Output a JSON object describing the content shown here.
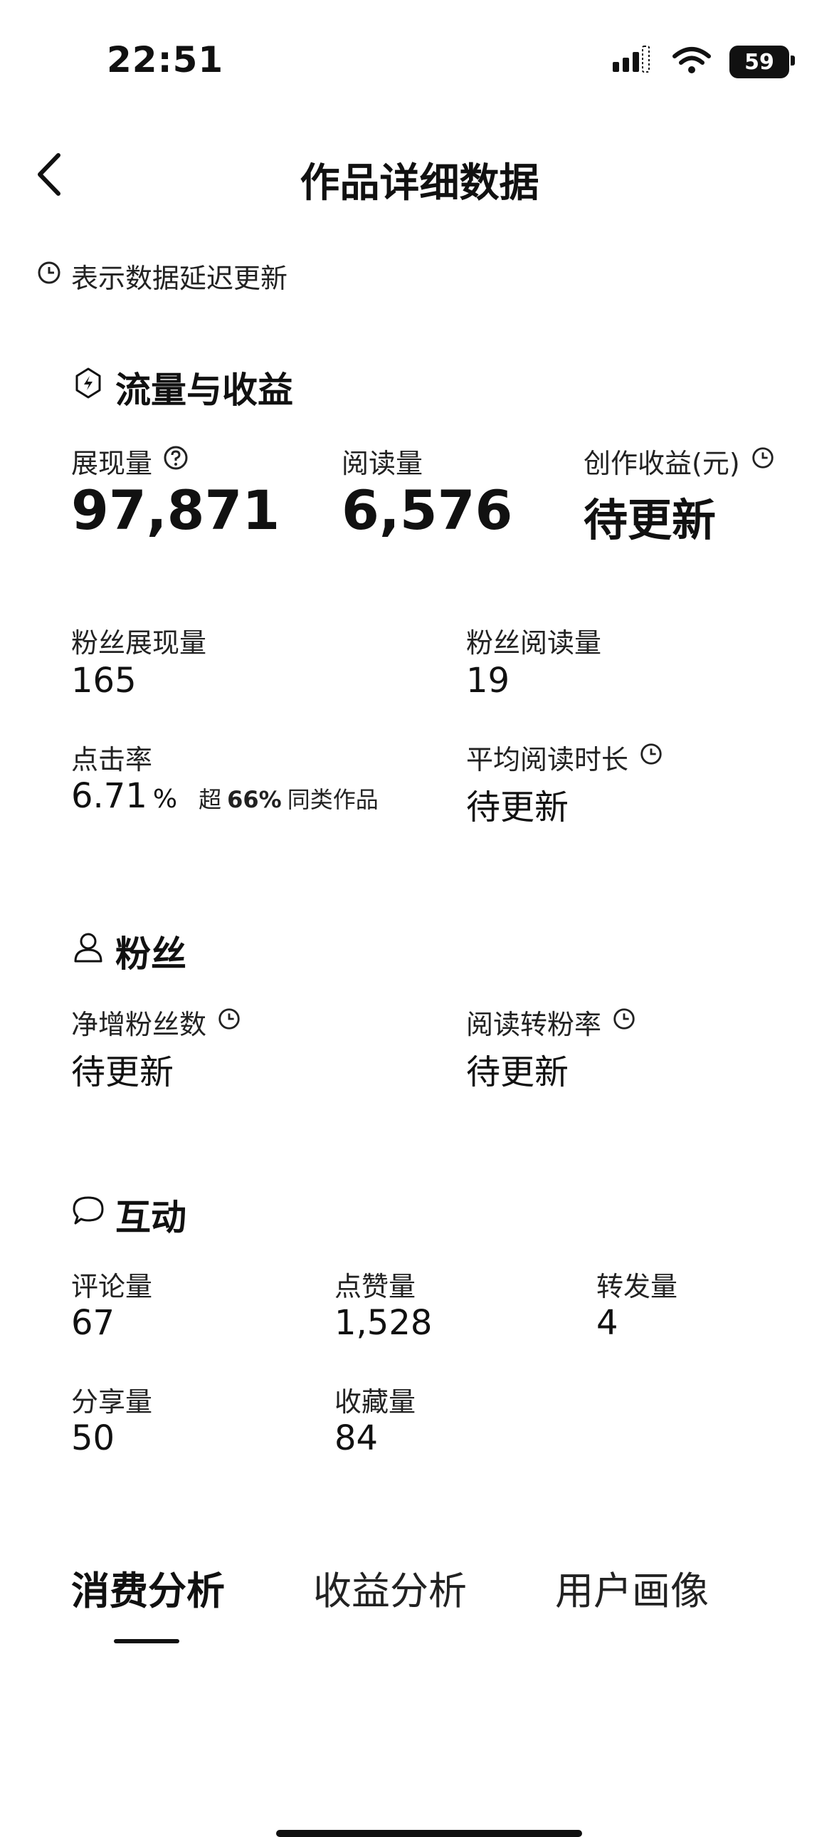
{
  "status_bar": {
    "time": "22:51",
    "battery": "59"
  },
  "nav": {
    "title": "作品详细数据"
  },
  "note": {
    "text": "表示数据延迟更新"
  },
  "traffic": {
    "title": "流量与收益",
    "impressions": {
      "label": "展现量",
      "value": "97,871"
    },
    "reads": {
      "label": "阅读量",
      "value": "6,576"
    },
    "earnings": {
      "label": "创作收益(元)",
      "value": "待更新"
    },
    "fan_impressions": {
      "label": "粉丝展现量",
      "value": "165"
    },
    "fan_reads": {
      "label": "粉丝阅读量",
      "value": "19"
    },
    "ctr": {
      "label": "点击率",
      "value": "6.71",
      "unit": "%",
      "compare_prefix": "超",
      "compare_value": "66%",
      "compare_suffix": "同类作品"
    },
    "avg_read_time": {
      "label": "平均阅读时长",
      "value": "待更新"
    }
  },
  "fans": {
    "title": "粉丝",
    "net_gain": {
      "label": "净增粉丝数",
      "value": "待更新"
    },
    "conversion": {
      "label": "阅读转粉率",
      "value": "待更新"
    }
  },
  "interaction": {
    "title": "互动",
    "comments": {
      "label": "评论量",
      "value": "67"
    },
    "likes": {
      "label": "点赞量",
      "value": "1,528"
    },
    "forwards": {
      "label": "转发量",
      "value": "4"
    },
    "shares": {
      "label": "分享量",
      "value": "50"
    },
    "favorites": {
      "label": "收藏量",
      "value": "84"
    }
  },
  "tabs": [
    {
      "label": "消费分析",
      "active": true
    },
    {
      "label": "收益分析",
      "active": false
    },
    {
      "label": "用户画像",
      "active": false
    }
  ]
}
